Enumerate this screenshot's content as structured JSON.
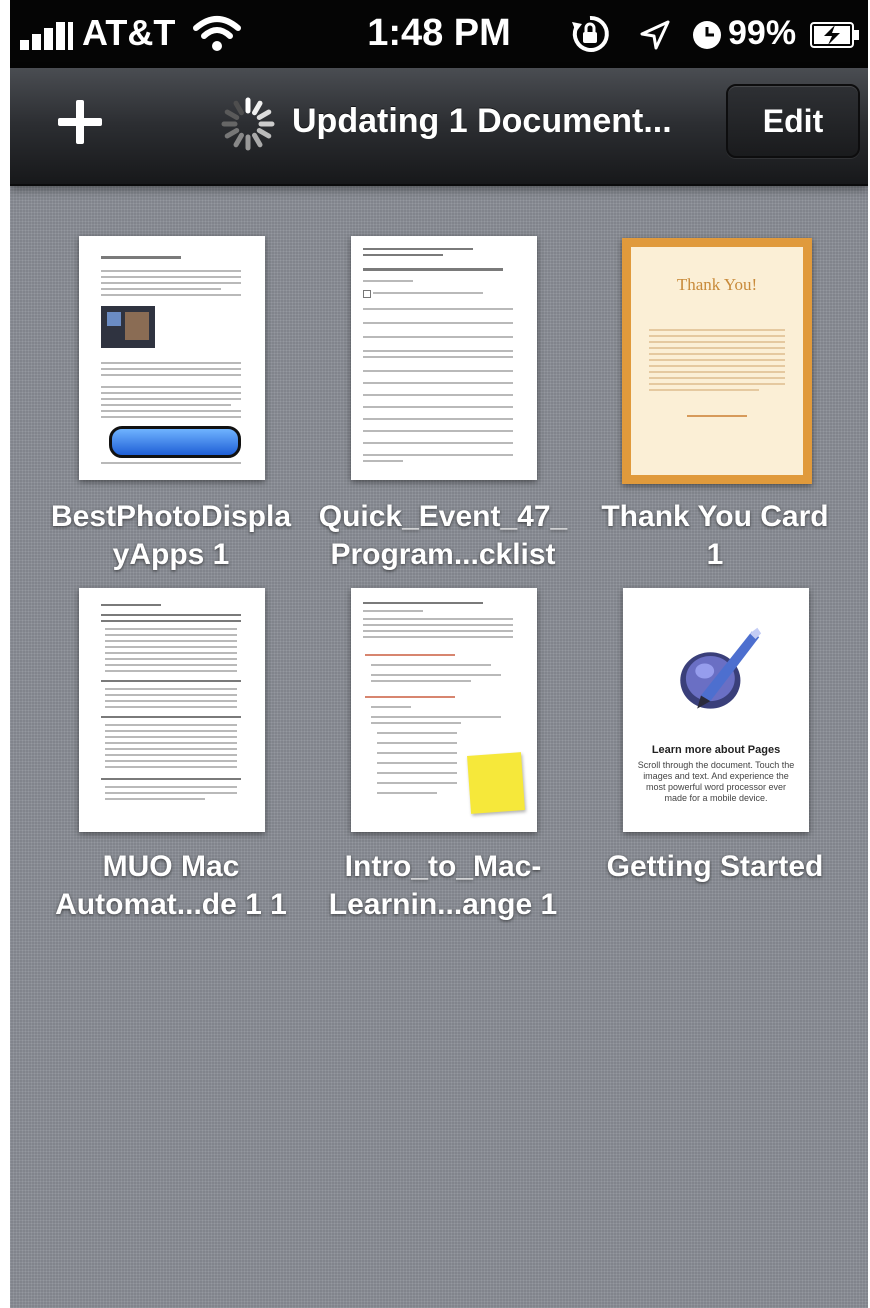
{
  "status_bar": {
    "carrier": "AT&T",
    "time": "1:48 PM",
    "battery_percent": "99%"
  },
  "nav": {
    "title": "Updating 1 Document...",
    "edit_label": "Edit"
  },
  "documents": [
    {
      "name_line1": "BestPhotoDispla",
      "name_line2": "yApps 1"
    },
    {
      "name_line1": "Quick_Event_47_",
      "name_line2": "Program...cklist"
    },
    {
      "name_line1": "Thank You Card",
      "name_line2": "1",
      "thumb_title": "Thank You!"
    },
    {
      "name_line1": "MUO Mac",
      "name_line2": "Automat...de 1 1"
    },
    {
      "name_line1": "Intro_to_Mac-",
      "name_line2": "Learnin...ange 1"
    },
    {
      "name_line1": "Getting Started",
      "name_line2": "",
      "thumb_title": "Learn more about Pages",
      "thumb_text": "Scroll through the document. Touch the images and text. And experience the most powerful word processor ever made for a mobile device."
    }
  ],
  "colors": {
    "status_bar": "#050505",
    "background": "#8a8e96",
    "card_border": "#e09a3c"
  }
}
